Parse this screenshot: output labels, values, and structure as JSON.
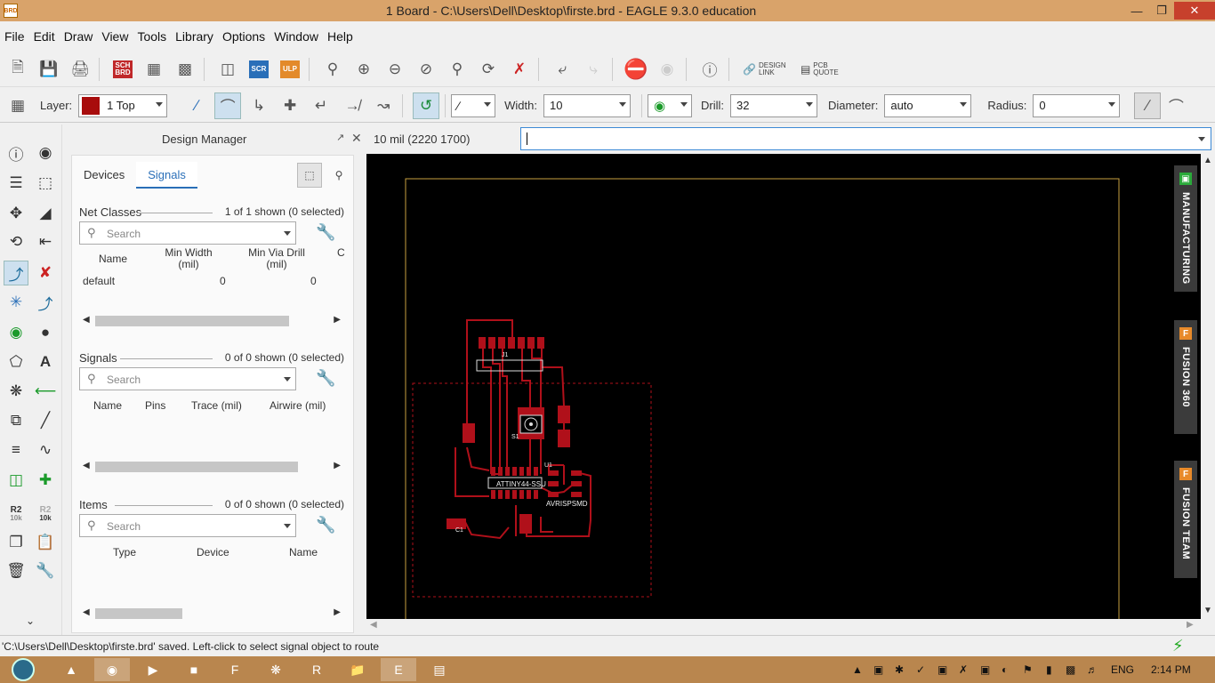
{
  "window": {
    "title": "1 Board - C:\\Users\\Dell\\Desktop\\firste.brd - EAGLE 9.3.0 education",
    "app_icon": "BRD",
    "buttons": [
      "minimize",
      "restore",
      "close"
    ]
  },
  "menu": [
    "File",
    "Edit",
    "Draw",
    "View",
    "Tools",
    "Library",
    "Options",
    "Window",
    "Help"
  ],
  "toolbar": {
    "sch_label": "SCH BRD",
    "scr_label": "SCR",
    "ulp_label": "ULP",
    "design_link": "DESIGN LINK",
    "pcb_quote": "PCB QUOTE"
  },
  "params": {
    "layer_label": "Layer:",
    "layer_value": "1 Top",
    "layer_color": "#a80c0c",
    "width_label": "Width:",
    "width_value": "10",
    "drill_label": "Drill:",
    "drill_value": "32",
    "diameter_label": "Diameter:",
    "diameter_value": "auto",
    "radius_label": "Radius:",
    "radius_value": "0"
  },
  "left_tools": {
    "r2_a": "R2",
    "r2_a_val": "10k",
    "r2_b": "R2",
    "r2_b_val": "10k"
  },
  "design_manager": {
    "title": "Design Manager",
    "tabs": [
      "Devices",
      "Signals"
    ],
    "active_tab": "Signals",
    "net_classes": {
      "title": "Net Classes",
      "count": "1 of 1 shown (0 selected)",
      "search_placeholder": "Search",
      "columns": [
        "Name",
        "Min Width\n(mil)",
        "Min Via Drill\n(mil)",
        "C"
      ],
      "rows": [
        {
          "name": "default",
          "min_width": "0",
          "min_via_drill": "0"
        }
      ]
    },
    "signals": {
      "title": "Signals",
      "count": "0 of 0 shown (0 selected)",
      "search_placeholder": "Search",
      "columns": [
        "Name",
        "Pins",
        "Trace (mil)",
        "Airwire (mil)"
      ]
    },
    "items": {
      "title": "Items",
      "count": "0 of 0 shown (0 selected)",
      "search_placeholder": "Search",
      "columns": [
        "Type",
        "Device",
        "Name"
      ]
    }
  },
  "coordinates": "10 mil (2220 1700)",
  "command_line": "",
  "side_tabs": [
    "MANUFACTURING",
    "FUSION 360",
    "FUSION TEAM"
  ],
  "board_labels": {
    "chip": "ATTINY44-SSU",
    "prog": "AVRISPSMD",
    "s1": "S1",
    "c1": "C1",
    "u1": "U1",
    "j1": "J1"
  },
  "status_message": "'C:\\Users\\Dell\\Desktop\\firste.brd' saved. Left-click to select signal object to route",
  "taskbar": {
    "lang": "ENG",
    "time": "2:14 PM"
  },
  "colors": {
    "title_bar": "#d9a36a",
    "taskbar": "#b9864e",
    "copper": "#b0101a",
    "board_outline": "#c8a040",
    "accent": "#2a6fb8"
  }
}
